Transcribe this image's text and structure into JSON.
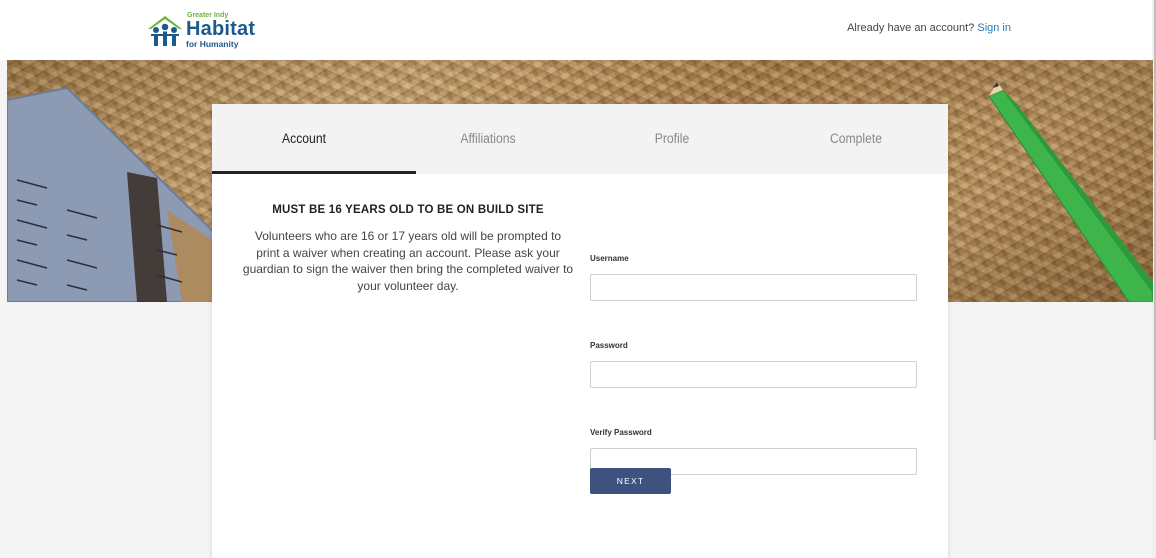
{
  "header": {
    "logo": {
      "small": "Greater Indy",
      "main": "Habitat",
      "sub": "for Humanity"
    },
    "account_prompt": "Already have an account?",
    "signin_link": "Sign in"
  },
  "steps": [
    {
      "label": "Account",
      "active": true
    },
    {
      "label": "Affiliations",
      "active": false
    },
    {
      "label": "Profile",
      "active": false
    },
    {
      "label": "Complete",
      "active": false
    }
  ],
  "notice": {
    "title": "MUST BE 16 YEARS OLD TO BE ON BUILD SITE",
    "body": "Volunteers who are 16 or 17 years old will be prompted to print a waiver when creating an account. Please ask your guardian to sign the waiver then bring the completed waiver to your volunteer day."
  },
  "form": {
    "username": {
      "label": "Username",
      "value": ""
    },
    "password": {
      "label": "Password",
      "value": ""
    },
    "verify_password": {
      "label": "Verify Password",
      "value": ""
    },
    "next_label": "NEXT"
  },
  "colors": {
    "brand_blue": "#1d5a8c",
    "brand_green": "#6db33f",
    "button": "#3e5280",
    "link": "#2a7ab5"
  }
}
